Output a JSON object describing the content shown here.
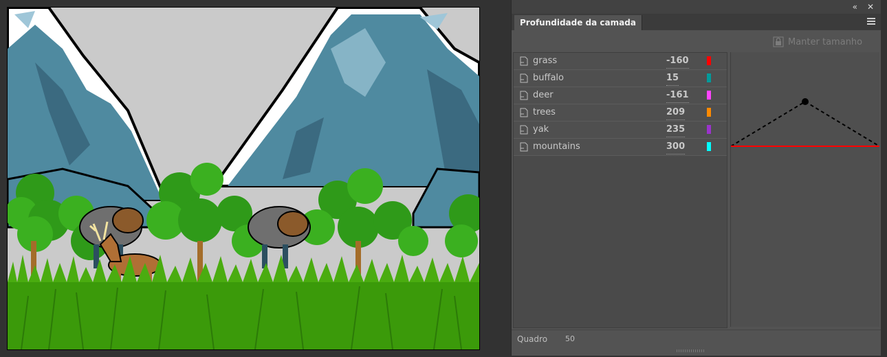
{
  "panel": {
    "collapse_icon": "double-chevron-left-icon",
    "close_icon": "close-icon",
    "tab_label": "Profundidade da camada",
    "menu_icon": "hamburger-menu-icon",
    "maintain_size_label": "Manter tamanho",
    "layers": [
      {
        "name": "grass",
        "depth": "-160",
        "color": "#ff0000"
      },
      {
        "name": "buffalo",
        "depth": "15",
        "color": "#009b9b"
      },
      {
        "name": "deer",
        "depth": "-161",
        "color": "#ff44ff"
      },
      {
        "name": "trees",
        "depth": "209",
        "color": "#ff8a00"
      },
      {
        "name": "yak",
        "depth": "235",
        "color": "#9b33cc"
      },
      {
        "name": "mountains",
        "depth": "300",
        "color": "#00ffff"
      }
    ],
    "frame_label": "Quadro",
    "frame_value": "50"
  },
  "colors": {
    "sky": "#cacaca",
    "mountain": "#4f8aa0",
    "mountain_shadow": "#3b6a80",
    "snow": "#ffffff",
    "tree": "#2f9a19",
    "grass": "#3b9a0a",
    "panel_bg": "#535353"
  }
}
